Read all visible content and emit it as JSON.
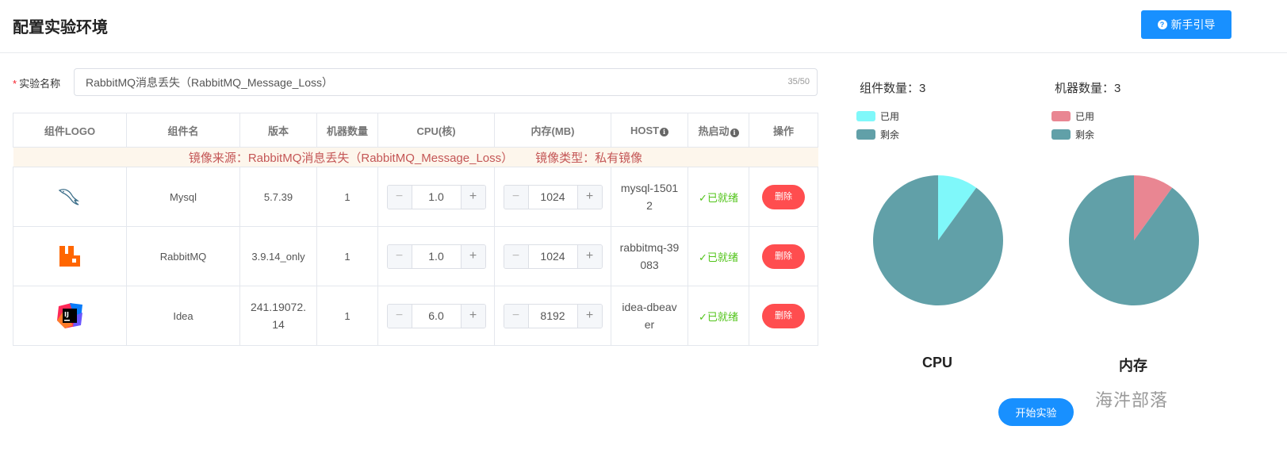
{
  "header": {
    "title": "配置实验环境",
    "guide_button": "新手引导"
  },
  "experiment": {
    "name_label": "实验名称",
    "name_value": "RabbitMQ消息丢失（RabbitMQ_Message_Loss）",
    "char_count": "35/50"
  },
  "table": {
    "headers": [
      "组件LOGO",
      "组件名",
      "版本",
      "机器数量",
      "CPU(核)",
      "内存(MB)",
      "HOST",
      "热启动",
      "操作"
    ],
    "source_label": "镜像来源：RabbitMQ消息丢失（RabbitMQ_Message_Loss）",
    "type_label": "镜像类型：私有镜像",
    "rows": [
      {
        "logo": "mysql-logo",
        "name": "Mysql",
        "version": "5.7.39",
        "machines": "1",
        "cpu": "1.0",
        "memory": "1024",
        "host": "mysql-15012",
        "status": "已就绪",
        "action": "删除"
      },
      {
        "logo": "rabbitmq-logo",
        "name": "RabbitMQ",
        "version": "3.9.14_only",
        "machines": "1",
        "cpu": "1.0",
        "memory": "1024",
        "host": "rabbitmq-39083",
        "status": "已就绪",
        "action": "删除"
      },
      {
        "logo": "intellij-idea-logo",
        "name": "Idea",
        "version": "241.19072.14",
        "machines": "1",
        "cpu": "6.0",
        "memory": "8192",
        "host": "idea-dbeaver",
        "status": "已就绪",
        "action": "删除"
      }
    ]
  },
  "stats": {
    "component_count": "组件数量：3",
    "machine_count": "机器数量：3"
  },
  "chart_data": [
    {
      "type": "pie",
      "title": "CPU",
      "legend": [
        "已用",
        "剩余"
      ],
      "values": [
        0.1,
        0.9
      ],
      "colors": [
        "#7ff8fa",
        "#61a0a8"
      ]
    },
    {
      "type": "pie",
      "title": "内存",
      "legend": [
        "已用",
        "剩余"
      ],
      "values": [
        0.1,
        0.9
      ],
      "colors": [
        "#e98692",
        "#61a0a8"
      ]
    }
  ],
  "actions": {
    "start_button": "开始实验"
  },
  "watermark": "海汼部落"
}
